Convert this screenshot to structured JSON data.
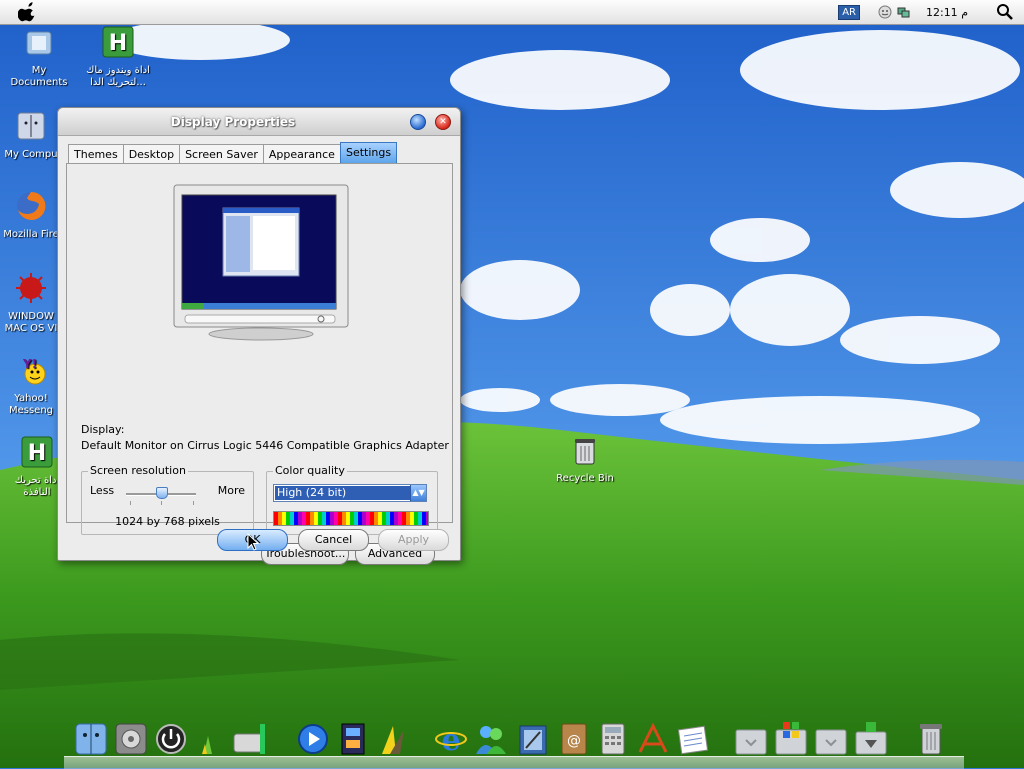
{
  "menubar": {
    "language": "AR",
    "clock": "12:11 م"
  },
  "desktop_icons": [
    {
      "label": "My Documents"
    },
    {
      "label": "اداة ويندوز ماك لتحريك الدا..."
    },
    {
      "label": "My Compu"
    },
    {
      "label": "Mozilla Fire"
    },
    {
      "label": "WINDOW MAC OS VI"
    },
    {
      "label": "Yahoo! Messeng"
    },
    {
      "label": "اداة تحريك النافذة"
    },
    {
      "label": "Recycle Bin"
    }
  ],
  "dialog": {
    "title": "Display Properties",
    "tabs": [
      {
        "label": "Themes"
      },
      {
        "label": "Desktop"
      },
      {
        "label": "Screen Saver"
      },
      {
        "label": "Appearance"
      },
      {
        "label": "Settings"
      }
    ],
    "display_label": "Display:",
    "display_adapter": "Default Monitor on Cirrus Logic 5446 Compatible Graphics Adapter",
    "resolution": {
      "title": "Screen resolution",
      "less": "Less",
      "more": "More",
      "value": "1024 by 768 pixels",
      "slider_fraction": 0.5
    },
    "color_quality": {
      "title": "Color quality",
      "selected": "High (24 bit)"
    },
    "buttons": {
      "troubleshoot": "Troubleshoot...",
      "advanced": "Advanced",
      "ok": "OK",
      "cancel": "Cancel",
      "apply": "Apply"
    }
  },
  "dock_items": [
    "finder-icon",
    "system-preferences-icon",
    "power-icon",
    "graph-icon",
    "drive-icon",
    "media-player-icon",
    "film-icon",
    "dashboard-icon",
    "internet-explorer-icon",
    "messenger-icon",
    "mail-icon",
    "address-book-icon",
    "calculator-icon",
    "app-store-icon",
    "notes-icon",
    "dock-folder-icon",
    "windows-logo-icon",
    "dock-folder-icon",
    "downloads-icon",
    "trash-icon"
  ],
  "colors": {
    "sky": "#2f7ad8",
    "grass": "#3a9a1c",
    "tab_active": "#5aa2ea"
  }
}
